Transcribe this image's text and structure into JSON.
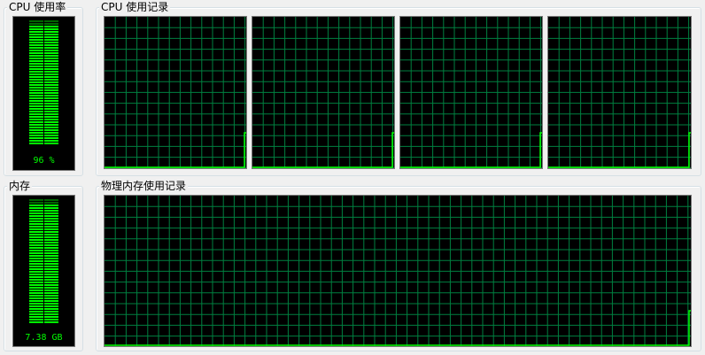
{
  "cpu_usage": {
    "title": "CPU 使用率",
    "value_label": "96 %",
    "level": 0.96
  },
  "cpu_history": {
    "title": "CPU 使用记录",
    "core_count": 4
  },
  "memory": {
    "title": "内存",
    "value_label": "7.38 GB",
    "level": 0.95
  },
  "memory_history": {
    "title": "物理内存使用记录"
  },
  "colors": {
    "meter_active": "#00ff00",
    "meter_inactive": "#006600",
    "grid": "#008040",
    "line": "#00ff00",
    "background": "#000000"
  }
}
